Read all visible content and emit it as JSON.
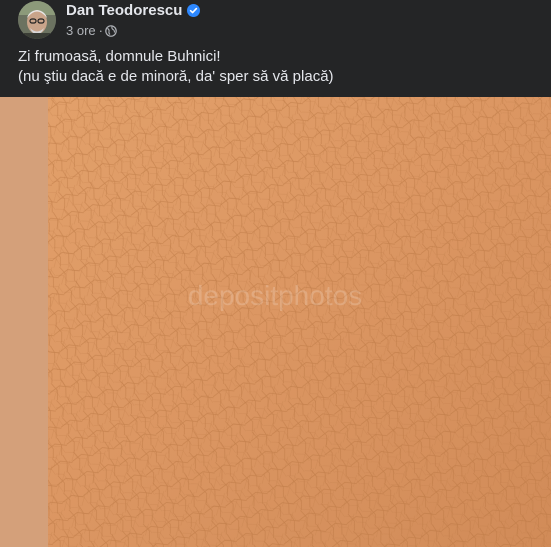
{
  "post": {
    "author": {
      "name": "Dan Teodorescu",
      "verified_icon": "verified-badge-icon",
      "avatar_icon": "avatar"
    },
    "timestamp": "3 ore",
    "separator": "·",
    "privacy_icon": "globe-icon",
    "text_lines": [
      "Zi frumoasă, domnule Buhnici!",
      "(nu ştiu dacă e de minoră, da' sper să vă placă)"
    ],
    "image": {
      "description_icon": "skin-texture-photo",
      "watermark": "depositphotos"
    }
  },
  "colors": {
    "background": "#242526",
    "text_primary": "#e4e6eb",
    "text_secondary": "#b0b3b8",
    "verified": "#2d88ff",
    "skin": "#d9955f"
  }
}
